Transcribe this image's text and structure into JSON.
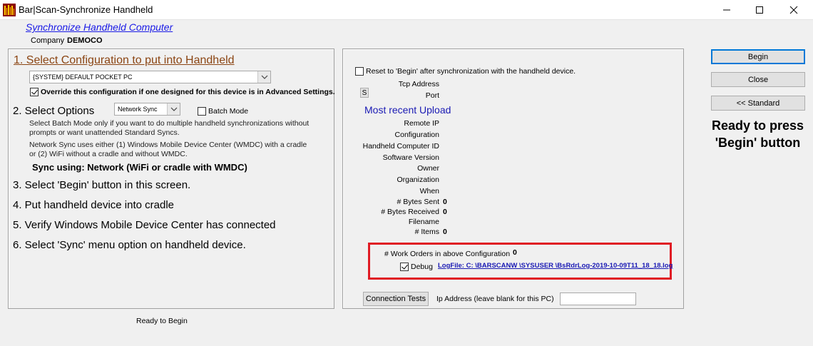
{
  "window": {
    "title": "Bar|Scan-Synchronize Handheld"
  },
  "header": {
    "heading": "Synchronize Handheld Computer",
    "company_label": "Company",
    "company_value": "DEMOCO"
  },
  "left_panel": {
    "step1_title": "1. Select Configuration to put into Handheld",
    "config_selected": "{SYSTEM} DEFAULT POCKET PC",
    "override_label": "Override this configuration if one designed  for this device is in Advanced Settings.",
    "override_checked": true,
    "step2_title": "2. Select Options",
    "sync_mode_selected": "Network Sync",
    "batch_mode_label": "Batch Mode",
    "batch_mode_checked": false,
    "batch_help": "Select Batch Mode only if you want to do multiple handheld synchronizations without prompts or want unattended Standard Syncs.",
    "network_help": "Network Sync uses either (1) Windows Mobile Device Center (WMDC)  with a cradle or (2) WiFi without a cradle and without WMDC.",
    "sync_using": "Sync using: Network (WiFi or cradle with WMDC)",
    "step3": "3. Select 'Begin' button in this screen.",
    "step4": "4. Put handheld device into cradle",
    "step5": "5. Verify Windows Mobile Device Center has connected",
    "step6": "6. Select 'Sync' menu option on handheld device."
  },
  "right_panel": {
    "reset_label": "Reset to 'Begin' after synchronization with the handheld device.",
    "reset_checked": false,
    "tcp_label": "Tcp Address",
    "s_button": "S",
    "port_label": "Port",
    "upload_heading": "Most recent Upload",
    "fields": {
      "remote_ip": "Remote IP",
      "configuration": "Configuration",
      "handheld_id": "Handheld Computer ID",
      "software_version": "Software Version",
      "owner": "Owner",
      "organization": "Organization",
      "when": "When",
      "bytes_sent": "# Bytes Sent",
      "bytes_sent_value": "0",
      "bytes_received": "# Bytes Received",
      "bytes_received_value": "0",
      "filename": "Filename",
      "items": "# Items",
      "items_value": "0"
    },
    "work_orders_label": "# Work Orders in above Configuration",
    "work_orders_value": "0",
    "debug_label": "Debug",
    "debug_checked": true,
    "logfile_link": "LogFile: C: \\BARSCANW \\SYSUSER \\BsRdrLog-2019-10-09T11_18_18.log",
    "connection_tests_button": "Connection Tests",
    "ip_address_label": "Ip Address (leave blank for this PC)",
    "ip_address_value": ""
  },
  "sidebar": {
    "begin_button": "Begin",
    "close_button": "Close",
    "standard_button": "<< Standard",
    "ready_message": "Ready to press 'Begin' button"
  },
  "status": {
    "text": "Ready to Begin"
  },
  "colors": {
    "heading_link": "#1a1ae6",
    "step1_title": "#8b4513",
    "upload_heading": "#1a1ab4",
    "highlight_box": "#e01b24"
  },
  "icons": {
    "app": "barscan-app-icon",
    "minimize": "minimize-icon",
    "maximize": "maximize-icon",
    "close": "close-icon",
    "dropdown": "chevron-down-icon"
  }
}
